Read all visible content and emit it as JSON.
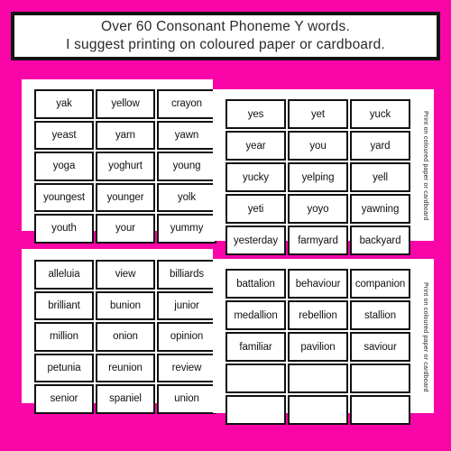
{
  "page": {
    "background_color": "#fa06a8",
    "sheet_color": "#ffffff",
    "ink_color": "#111111"
  },
  "header": {
    "line1": "Over 60 Consonant Phoneme Y words.",
    "line2": "I suggest printing on coloured paper or cardboard."
  },
  "side_captions": {
    "top": "Print on coloured paper or cardboard",
    "bottom": "Print on coloured paper or cardboard"
  },
  "tables": [
    {
      "id": "table-1",
      "position": "top-left",
      "rows": [
        [
          "yak",
          "yellow",
          "crayon"
        ],
        [
          "yeast",
          "yarn",
          "yawn"
        ],
        [
          "yoga",
          "yoghurt",
          "young"
        ],
        [
          "youngest",
          "younger",
          "yolk"
        ],
        [
          "youth",
          "your",
          "yummy"
        ]
      ]
    },
    {
      "id": "table-2",
      "position": "top-right",
      "rows": [
        [
          "yes",
          "yet",
          "yuck"
        ],
        [
          "year",
          "you",
          "yard"
        ],
        [
          "yucky",
          "yelping",
          "yell"
        ],
        [
          "yeti",
          "yoyo",
          "yawning"
        ],
        [
          "yesterday",
          "farmyard",
          "backyard"
        ]
      ]
    },
    {
      "id": "table-3",
      "position": "bottom-left",
      "rows": [
        [
          "alleluia",
          "view",
          "billiards"
        ],
        [
          "brilliant",
          "bunion",
          "junior"
        ],
        [
          "million",
          "onion",
          "opinion"
        ],
        [
          "petunia",
          "reunion",
          "review"
        ],
        [
          "senior",
          "spaniel",
          "union"
        ]
      ]
    },
    {
      "id": "table-4",
      "position": "bottom-right",
      "rows": [
        [
          "battalion",
          "behaviour",
          "companion"
        ],
        [
          "medallion",
          "rebellion",
          "stallion"
        ],
        [
          "familiar",
          "pavilion",
          "saviour"
        ],
        [
          "",
          "",
          ""
        ],
        [
          "",
          "",
          ""
        ]
      ]
    }
  ]
}
